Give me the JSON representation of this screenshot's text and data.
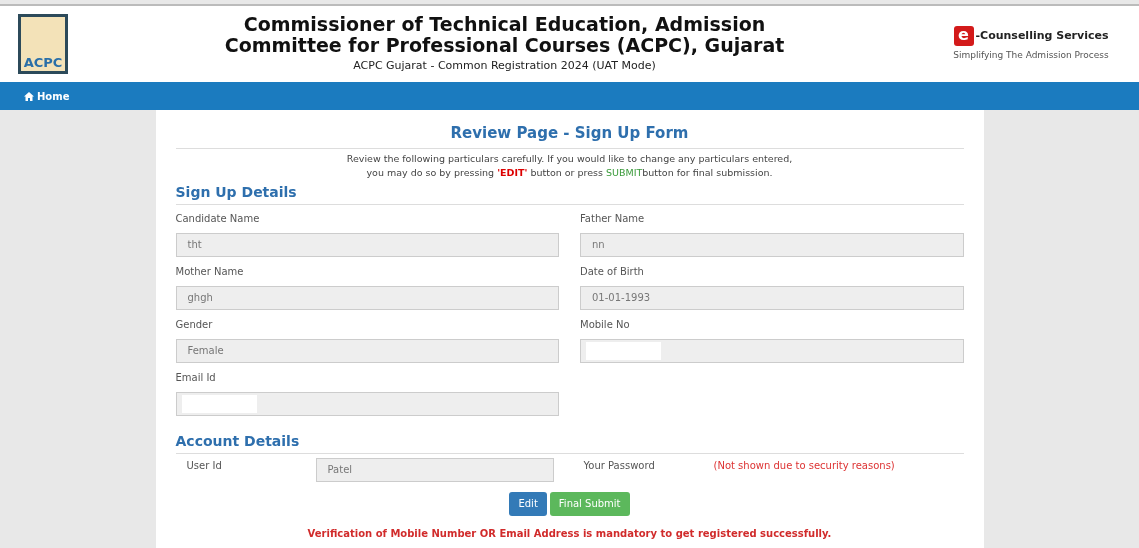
{
  "header": {
    "title_line1": "Commissioner of Technical Education, Admission",
    "title_line2": "Committee for Professional Courses (ACPC), Gujarat",
    "subtitle": "ACPC Gujarat - Common Registration 2024 (UAT Mode)",
    "logo_text": "ACPC",
    "brand_logo_glyph": "e",
    "brand_name": "-Counselling Services",
    "brand_tagline": "Simplifying The Admission Process"
  },
  "nav": [
    {
      "label": "Home",
      "selected": true
    }
  ],
  "page_title": "Review Page - Sign Up Form",
  "instructions": {
    "line1": "Review the following particulars carefully. If you would like to change any particulars entered,",
    "line2_start": "you may do so by pressing ",
    "edit_word": "'EDIT'",
    "line2_middle": " button or press ",
    "submit_word": "SUBMIT",
    "line2_end": "button for final submission."
  },
  "sign_up": {
    "heading": "Sign Up Details",
    "fields": [
      {
        "label": "Candidate Name",
        "kind": "text",
        "value": "tht"
      },
      {
        "label": "Father Name",
        "kind": "text",
        "value": "nn"
      },
      {
        "label": "Mother Name",
        "kind": "text",
        "value": "ghgh"
      },
      {
        "label": "Date of Birth",
        "kind": "text",
        "value": "01-01-1993"
      },
      {
        "label": "Gender",
        "kind": "text",
        "value": "Female"
      },
      {
        "label": "Mobile No",
        "kind": "redacted"
      },
      {
        "label": "Email Id",
        "kind": "redacted"
      }
    ]
  },
  "account": {
    "heading": "Account Details",
    "user_id_label": "User Id",
    "user_id_value": "Patel",
    "password_label": "Your Password",
    "password_note": "(Not shown due to security reasons)"
  },
  "buttons": [
    {
      "label": "Edit",
      "kind": "primary"
    },
    {
      "label": "Final Submit",
      "kind": "success"
    }
  ],
  "warning": "Verification of Mobile Number OR Email Address is mandatory to get registered successfully."
}
